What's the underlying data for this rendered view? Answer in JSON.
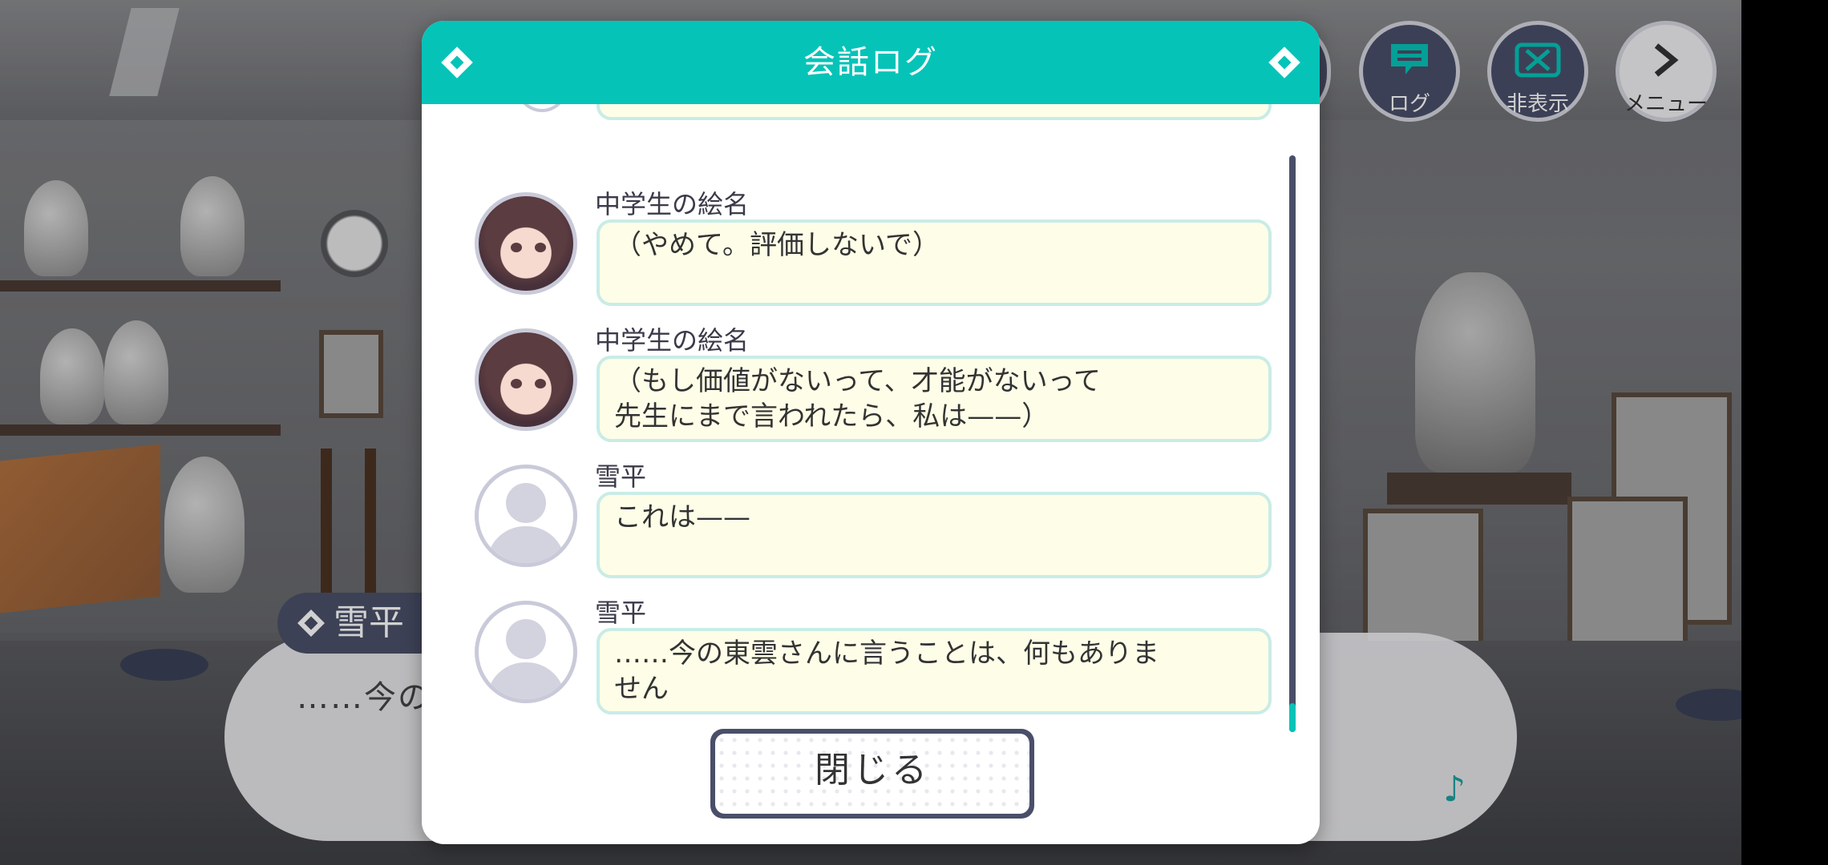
{
  "scene": {
    "dialog": {
      "speaker": "雪平",
      "text": "……今の"
    }
  },
  "top_buttons": {
    "log_label": "ログ",
    "hide_label": "非表示",
    "menu_label": "メニュー"
  },
  "modal": {
    "title": "会話ログ",
    "entries": [
      {
        "speaker": "中学生の絵名",
        "text": "（やめて。評価しないで）",
        "avatar": "ena-junior-avatar"
      },
      {
        "speaker": "中学生の絵名",
        "text": "（もし価値がないって、才能がないって\n先生にまで言われたら、私は——）",
        "avatar": "ena-junior-avatar"
      },
      {
        "speaker": "雪平",
        "text": "これは——",
        "avatar": "silhouette-avatar"
      },
      {
        "speaker": "雪平",
        "text": "……今の東雲さんに言うことは、何もありま\nせん",
        "avatar": "silhouette-avatar"
      }
    ],
    "close_label": "閉じる"
  },
  "colors": {
    "accent_teal": "#06c3b8",
    "button_navy": "#4a4f69",
    "bubble_fill": "#fefee8",
    "bubble_border": "#c9ece6"
  }
}
